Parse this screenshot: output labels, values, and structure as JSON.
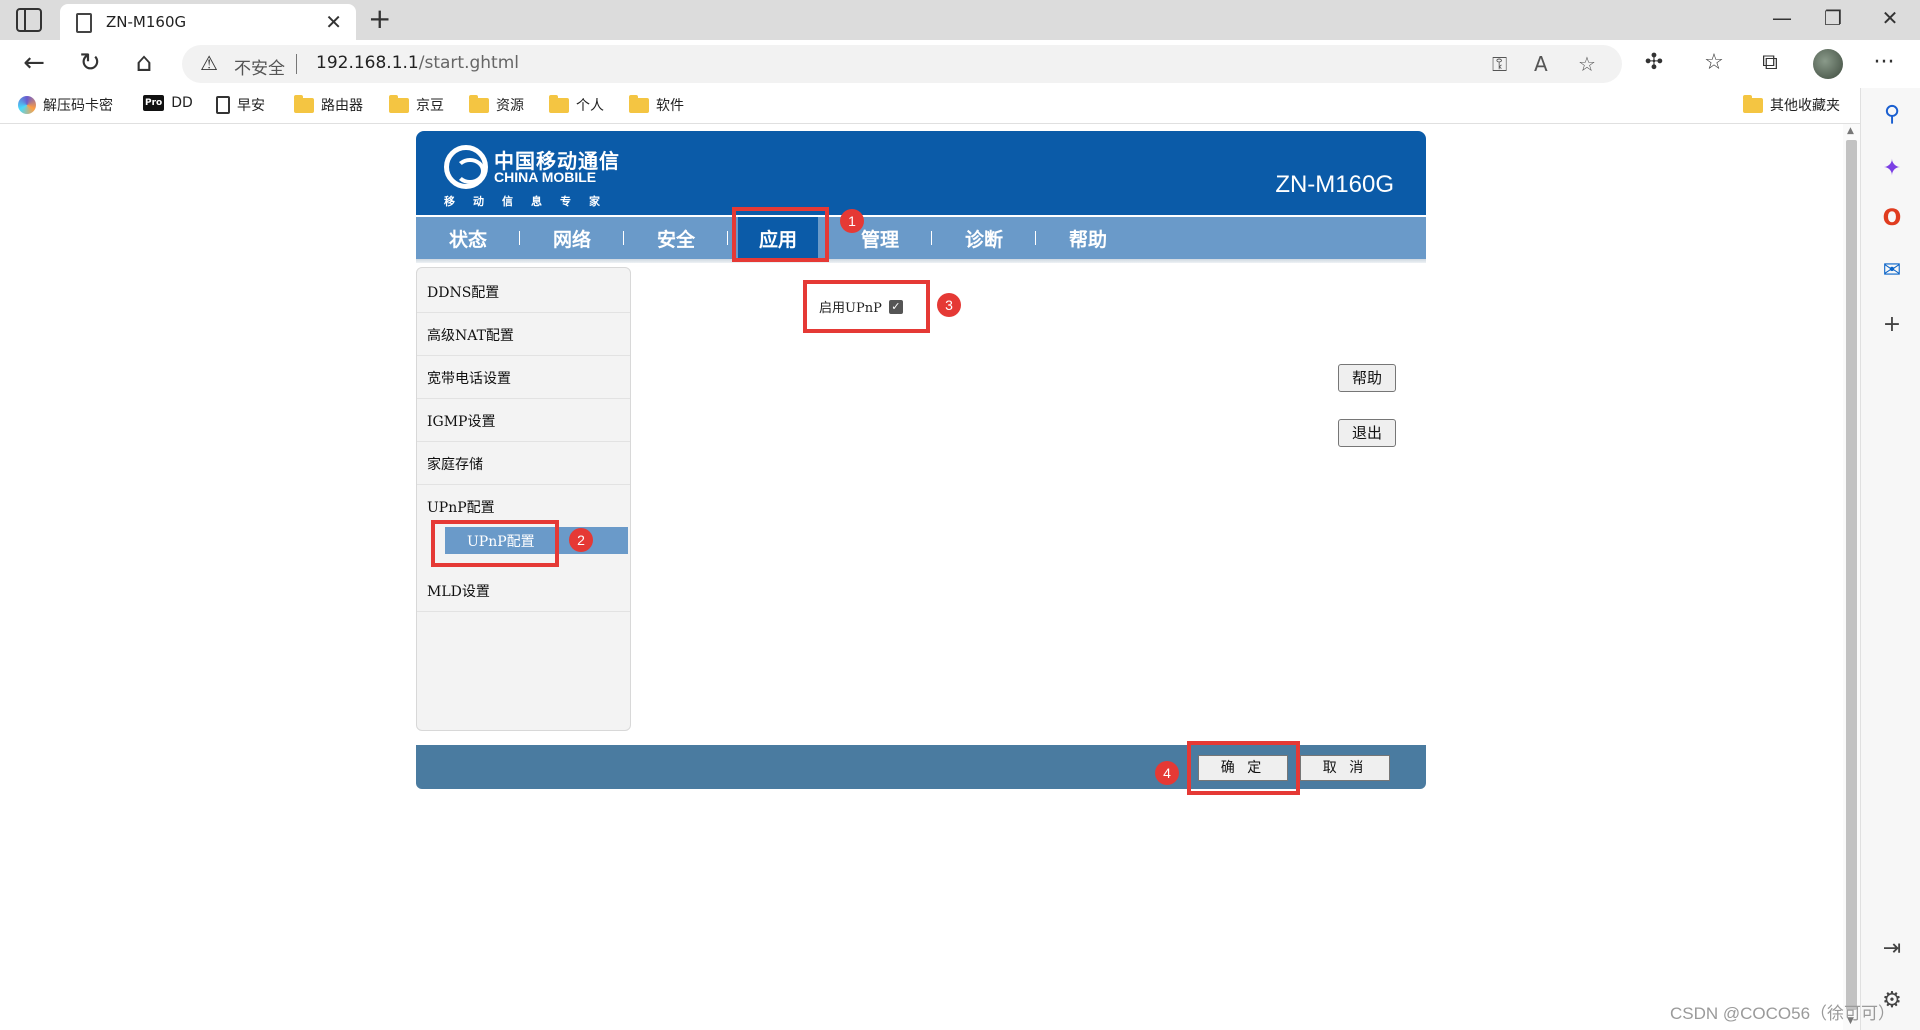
{
  "browser": {
    "tab_title": "ZN-M160G",
    "tab_close": "✕",
    "new_tab": "+",
    "security_label": "不安全",
    "url_host": "192.168.1.1",
    "url_path": "/start.ghtml",
    "bookmarks": [
      "解压码卡密",
      "DD",
      "早安",
      "路由器",
      "京豆",
      "资源",
      "个人",
      "软件"
    ],
    "other_bookmarks": "其他收藏夹",
    "pro_badge": "Pro"
  },
  "router": {
    "brand_cn": "中国移动通信",
    "brand_en": "CHINA MOBILE",
    "slogan": "移动信息专家",
    "model": "ZN-M160G",
    "nav": [
      "状态",
      "网络",
      "安全",
      "应用",
      "管理",
      "诊断",
      "帮助"
    ],
    "active_nav": "应用",
    "menu": [
      "DDNS配置",
      "高级NAT配置",
      "宽带电话设置",
      "IGMP设置",
      "家庭存储",
      "UPnP配置",
      "MLD设置"
    ],
    "submenu_active": "UPnP配置",
    "enable_upnp_label": "启用UPnP",
    "enable_upnp_checked": true,
    "help_button": "帮助",
    "logout_button": "退出",
    "ok_button": "确 定",
    "cancel_button": "取 消"
  },
  "annotations": [
    "1",
    "2",
    "3",
    "4"
  ],
  "colors": {
    "header_blue": "#0b5ba8",
    "nav_blue": "#6a9ac9",
    "footer_blue": "#4a7ba0",
    "annotation_red": "#e53935"
  },
  "watermark": "CSDN @COCO56（徐可可）"
}
